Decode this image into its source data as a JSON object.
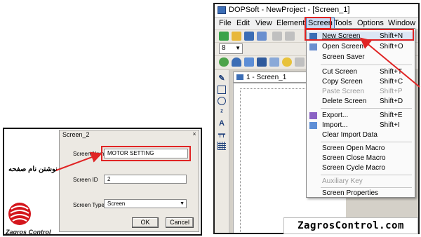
{
  "window": {
    "title": "DOPSoft - NewProject - [Screen_1]",
    "menu": [
      "File",
      "Edit",
      "View",
      "Element",
      "Screen",
      "Tools",
      "Options",
      "Window"
    ],
    "active_menu": "Screen",
    "toolbar_combo_value": "8",
    "doc_tab_label": "1 - Screen_1"
  },
  "screen_menu": {
    "items": [
      {
        "label": "New Screen",
        "shortcut": "Shift+N",
        "icon": "new-screen-icon",
        "highlighted": true,
        "enabled": true
      },
      {
        "label": "Open Screen",
        "shortcut": "Shift+O",
        "icon": "open-screen-icon",
        "enabled": true
      },
      {
        "label": "Screen Saver",
        "shortcut": "",
        "enabled": true
      },
      {
        "label": "Cut Screen",
        "shortcut": "Shift+T",
        "enabled": true
      },
      {
        "label": "Copy Screen",
        "shortcut": "Shift+C",
        "enabled": true
      },
      {
        "label": "Paste Screen",
        "shortcut": "Shift+P",
        "enabled": false
      },
      {
        "label": "Delete Screen",
        "shortcut": "Shift+D",
        "enabled": true
      },
      {
        "label": "Export...",
        "shortcut": "Shift+E",
        "icon": "export-icon",
        "enabled": true
      },
      {
        "label": "Import...",
        "shortcut": "Shift+I",
        "icon": "import-icon",
        "enabled": true
      },
      {
        "label": "Clear Import Data",
        "shortcut": "",
        "enabled": true
      },
      {
        "label": "Screen Open Macro",
        "shortcut": "",
        "enabled": true
      },
      {
        "label": "Screen Close Macro",
        "shortcut": "",
        "enabled": true
      },
      {
        "label": "Screen Cycle Macro",
        "shortcut": "",
        "enabled": true
      },
      {
        "label": "Auxiliary Key",
        "shortcut": "",
        "enabled": false
      },
      {
        "label": "Screen Properties",
        "shortcut": "",
        "enabled": true
      }
    ]
  },
  "dialog": {
    "title": "Screen_2",
    "close_glyph": "×",
    "screen_name_label": "Screen Name",
    "screen_name_value": "MOTOR SETTING",
    "screen_id_label": "Screen ID",
    "screen_id_value": "2",
    "screen_type_label": "Screen Type",
    "screen_type_value": "Screen",
    "ok_label": "OK",
    "cancel_label": "Cancel"
  },
  "annotation": {
    "persian_text": "نوشتن نام صفحه"
  },
  "branding": {
    "logo_text": "Zagros Control",
    "watermark": "ZagrosControl.com"
  },
  "colors": {
    "highlight_red": "#e02424",
    "menu_highlight": "#dce6f4",
    "logo_red": "#d4161c"
  }
}
